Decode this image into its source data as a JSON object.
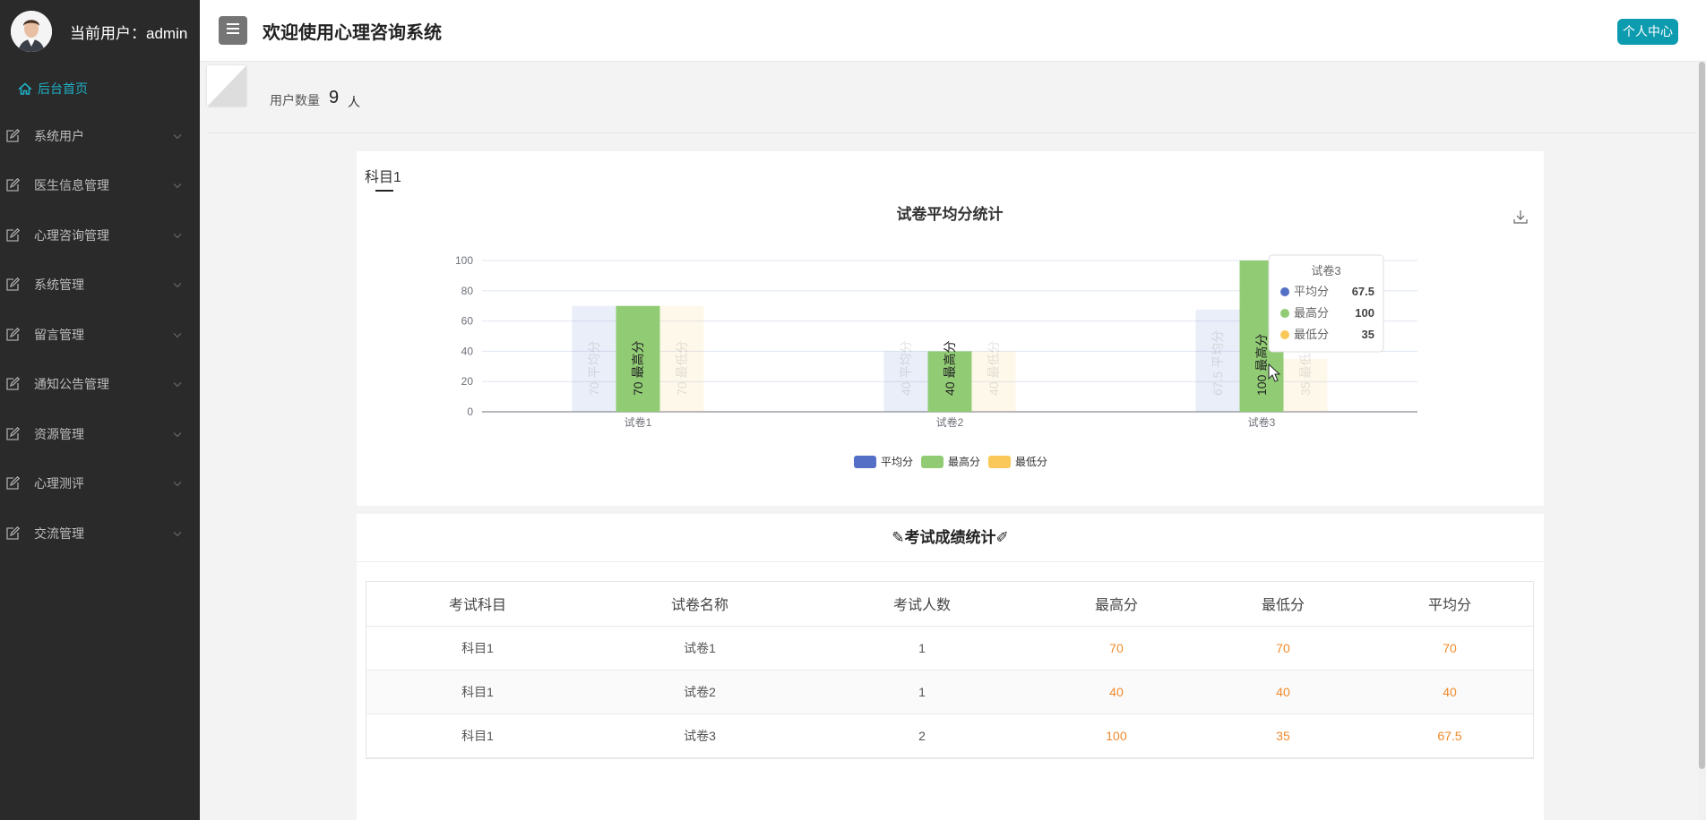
{
  "sidebar": {
    "user_label": "当前用户：admin",
    "items": [
      {
        "label": "后台首页"
      },
      {
        "label": "系统用户"
      },
      {
        "label": "医生信息管理"
      },
      {
        "label": "心理咨询管理"
      },
      {
        "label": "系统管理"
      },
      {
        "label": "留言管理"
      },
      {
        "label": "通知公告管理"
      },
      {
        "label": "资源管理"
      },
      {
        "label": "心理测评"
      },
      {
        "label": "交流管理"
      }
    ]
  },
  "header": {
    "title": "欢迎使用心理咨询系统",
    "profile_button": "个人中心"
  },
  "stats": {
    "label": "用户数量",
    "value": "9",
    "unit": "人"
  },
  "chart_panel": {
    "tab": "科目1"
  },
  "chart_data": {
    "type": "bar",
    "title": "试卷平均分统计",
    "categories": [
      "试卷1",
      "试卷2",
      "试卷3"
    ],
    "series": [
      {
        "name": "平均分",
        "values": [
          70,
          40,
          67.5
        ],
        "color": "#5470c6"
      },
      {
        "name": "最高分",
        "values": [
          70,
          40,
          100
        ],
        "color": "#91cc75"
      },
      {
        "name": "最低分",
        "values": [
          70,
          40,
          35
        ],
        "color": "#fac858"
      }
    ],
    "ylim": [
      0,
      100
    ],
    "yticks": [
      0,
      20,
      40,
      60,
      80,
      100
    ],
    "xlabel": "",
    "ylabel": "",
    "grid": true,
    "legend_position": "bottom",
    "highlighted_category": "试卷3",
    "tooltip": {
      "title": "试卷3",
      "rows": [
        {
          "name": "平均分",
          "value": "67.5"
        },
        {
          "name": "最高分",
          "value": "100"
        },
        {
          "name": "最低分",
          "value": "35"
        }
      ]
    }
  },
  "table": {
    "title": "考试成绩统计",
    "headers": [
      "考试科目",
      "试卷名称",
      "考试人数",
      "最高分",
      "最低分",
      "平均分"
    ],
    "rows": [
      [
        "科目1",
        "试卷1",
        "1",
        "70",
        "70",
        "70"
      ],
      [
        "科目1",
        "试卷2",
        "1",
        "40",
        "40",
        "40"
      ],
      [
        "科目1",
        "试卷3",
        "2",
        "100",
        "35",
        "67.5"
      ]
    ]
  },
  "colors": {
    "sidebar_bg": "#2a2a2a",
    "accent": "#0d9bb0",
    "score": "#f18a2b"
  }
}
